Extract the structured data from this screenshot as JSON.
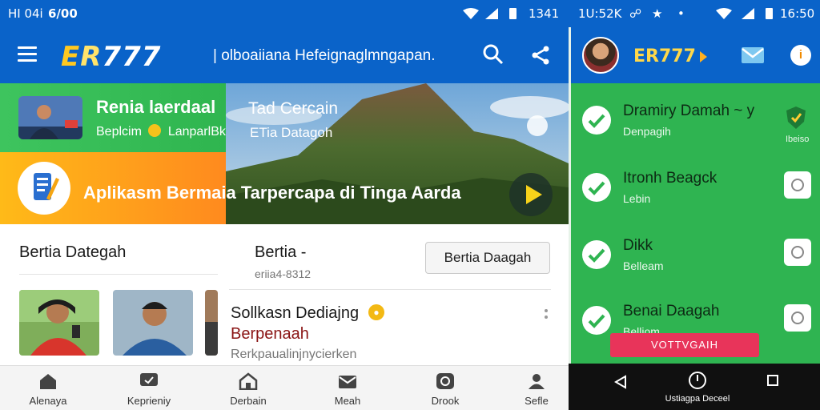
{
  "status_bar": {
    "left_time": "HI 04i",
    "left_extra": "6/00",
    "mid_time": "1341",
    "right_time": "1U:52K",
    "right_clock": "16:50"
  },
  "app_bar": {
    "logo_prefix": "E",
    "logo_mid": "R",
    "logo_suffix": "777",
    "title": "| olboaiiana Hefeignaglmngapan.",
    "icons": [
      "menu-icon",
      "search-icon",
      "share-icon"
    ]
  },
  "promos": {
    "promo1_title": "Renia laerdaal",
    "promo1_sub_a": "Beplcim",
    "promo1_sub_b": "LanparlBk",
    "promo2_text": "Aplikasm Bermaia Tarpercapa di Tinga Aarda"
  },
  "hero": {
    "title": "Tad Cercain",
    "subtitle": "ETia Datagoh"
  },
  "content": {
    "section_title": "Bertia Dategah",
    "block2_title": "Bertia -",
    "block2_sub": "eriia4-8312",
    "block2_button": "Bertia Daagah",
    "article_title": "Sollkasn Dediajng",
    "article_sub": "Berpenaah",
    "article_meta": "Rerkpaualinjnycierken"
  },
  "bottom_nav": [
    {
      "label": "Alenaya",
      "icon": "home-icon"
    },
    {
      "label": "Keprieniy",
      "icon": "chat-icon"
    },
    {
      "label": "Derbain",
      "icon": "house-icon"
    },
    {
      "label": "Meah",
      "icon": "mail-icon"
    },
    {
      "label": "Drook",
      "icon": "message-icon"
    },
    {
      "label": "Sefle",
      "icon": "profile-icon"
    }
  ],
  "right_panel": {
    "logo": "ER777",
    "shield_label": "Ibeiso",
    "items": [
      {
        "title": "Dramiry Damah ~ y",
        "sub": "Denpagih"
      },
      {
        "title": "Itronh Beagck",
        "sub": "Lebin"
      },
      {
        "title": "Dikk",
        "sub": "Belleam"
      },
      {
        "title": "Benai Daagah",
        "sub": "Belliom"
      }
    ],
    "action_button": "VOTTVGAIH"
  },
  "system_nav": {
    "label": "Ustiagpa Deceel"
  },
  "colors": {
    "primary_blue": "#0a63c9",
    "green": "#2fb451",
    "orange": "#ff8a1e",
    "accent_red": "#e8345a",
    "logo_yellow": "#ffc820"
  }
}
